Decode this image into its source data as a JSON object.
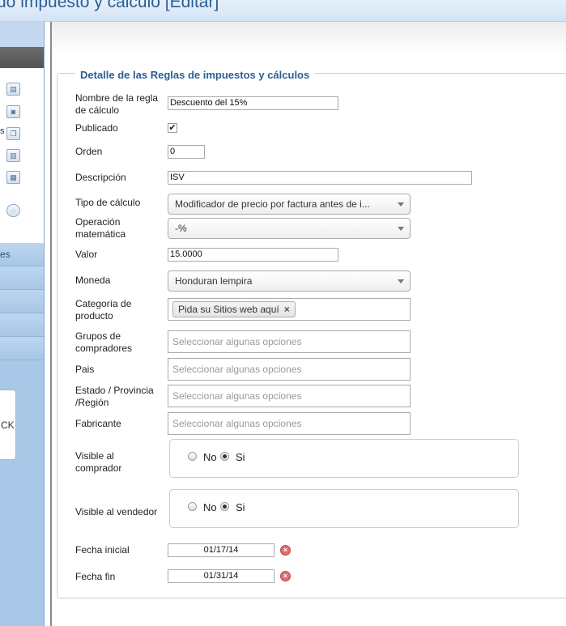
{
  "page": {
    "title": "do impuesto y cálculo [Editar]"
  },
  "sidebar": {
    "cut_label_1": "s",
    "cut_label_2": "es",
    "card_text": "CK"
  },
  "form": {
    "legend": "Detalle de las Reglas de impuestos y cálculos",
    "rule_name": {
      "label": "Nombre de la regla de cálculo",
      "value": "Descuento del 15%"
    },
    "published": {
      "label": "Publicado",
      "checked": true,
      "mark": "✔"
    },
    "order": {
      "label": "Orden",
      "value": "0"
    },
    "description": {
      "label": "Descripción",
      "value": "ISV"
    },
    "calc_type": {
      "label": "Tipo de cálculo",
      "value": "Modificador de precio por factura antes de i..."
    },
    "math_op": {
      "label": "Operación matemática",
      "value": "-%"
    },
    "value": {
      "label": "Valor",
      "value": "15.0000"
    },
    "currency": {
      "label": "Moneda",
      "value": "Honduran lempira"
    },
    "product_category": {
      "label": "Categoría de producto",
      "chip": "Pida su Sitios web aquí",
      "chip_remove": "×"
    },
    "buyer_groups": {
      "label": "Grupos de compradores",
      "placeholder": "Seleccionar algunas opciones"
    },
    "country": {
      "label": "Pais",
      "placeholder": "Seleccionar algunas opciones"
    },
    "state": {
      "label": "Estado / Provincia /Región",
      "placeholder": "Seleccionar algunas opciones"
    },
    "manufacturer": {
      "label": "Fabricante",
      "placeholder": "Seleccionar algunas opciones"
    },
    "visible_buyer": {
      "label": "Visible al comprador",
      "no": "No",
      "yes": "Si",
      "selected": "Si"
    },
    "visible_seller": {
      "label": "Visible al vendedor",
      "no": "No",
      "yes": "Si",
      "selected": "Si"
    },
    "start_date": {
      "label": "Fecha inicial",
      "value": "01/17/14"
    },
    "end_date": {
      "label": "Fecha fin",
      "value": "01/31/14"
    },
    "clear_icon": "×"
  }
}
